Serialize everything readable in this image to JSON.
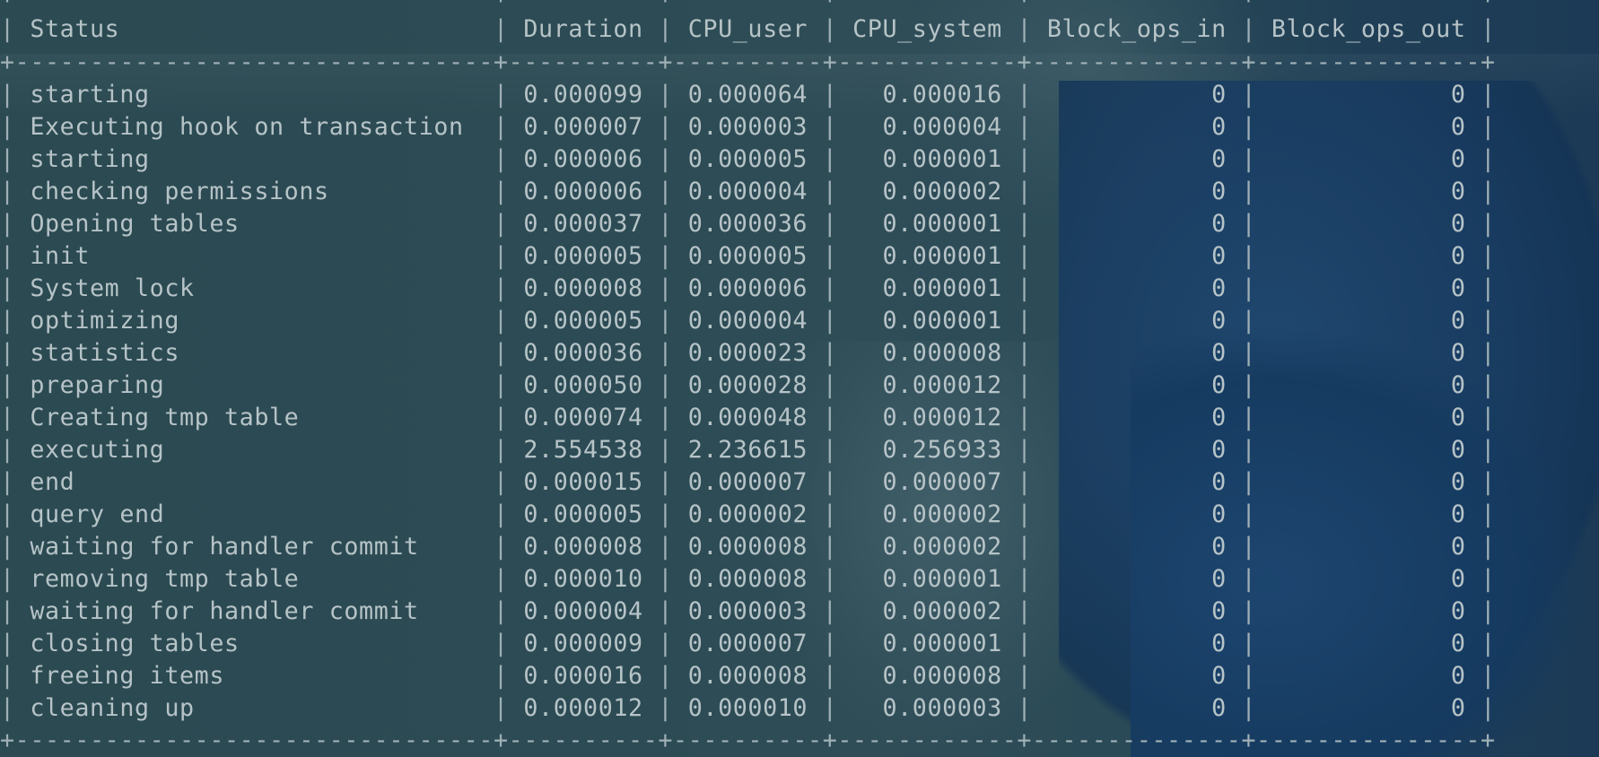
{
  "table": {
    "separator": "+--------------------------------+----------+----------+------------+--------------+---------------+",
    "columns": [
      "Status",
      "Duration",
      "CPU_user",
      "CPU_system",
      "Block_ops_in",
      "Block_ops_out"
    ],
    "rows": [
      [
        "starting",
        "0.000099",
        "0.000064",
        "0.000016",
        "0",
        "0"
      ],
      [
        "Executing hook on transaction",
        "0.000007",
        "0.000003",
        "0.000004",
        "0",
        "0"
      ],
      [
        "starting",
        "0.000006",
        "0.000005",
        "0.000001",
        "0",
        "0"
      ],
      [
        "checking permissions",
        "0.000006",
        "0.000004",
        "0.000002",
        "0",
        "0"
      ],
      [
        "Opening tables",
        "0.000037",
        "0.000036",
        "0.000001",
        "0",
        "0"
      ],
      [
        "init",
        "0.000005",
        "0.000005",
        "0.000001",
        "0",
        "0"
      ],
      [
        "System lock",
        "0.000008",
        "0.000006",
        "0.000001",
        "0",
        "0"
      ],
      [
        "optimizing",
        "0.000005",
        "0.000004",
        "0.000001",
        "0",
        "0"
      ],
      [
        "statistics",
        "0.000036",
        "0.000023",
        "0.000008",
        "0",
        "0"
      ],
      [
        "preparing",
        "0.000050",
        "0.000028",
        "0.000012",
        "0",
        "0"
      ],
      [
        "Creating tmp table",
        "0.000074",
        "0.000048",
        "0.000012",
        "0",
        "0"
      ],
      [
        "executing",
        "2.554538",
        "2.236615",
        "0.256933",
        "0",
        "0"
      ],
      [
        "end",
        "0.000015",
        "0.000007",
        "0.000007",
        "0",
        "0"
      ],
      [
        "query end",
        "0.000005",
        "0.000002",
        "0.000002",
        "0",
        "0"
      ],
      [
        "waiting for handler commit",
        "0.000008",
        "0.000008",
        "0.000002",
        "0",
        "0"
      ],
      [
        "removing tmp table",
        "0.000010",
        "0.000008",
        "0.000001",
        "0",
        "0"
      ],
      [
        "waiting for handler commit",
        "0.000004",
        "0.000003",
        "0.000002",
        "0",
        "0"
      ],
      [
        "closing tables",
        "0.000009",
        "0.000007",
        "0.000001",
        "0",
        "0"
      ],
      [
        "freeing items",
        "0.000016",
        "0.000008",
        "0.000008",
        "0",
        "0"
      ],
      [
        "cleaning up",
        "0.000012",
        "0.000010",
        "0.000003",
        "0",
        "0"
      ]
    ]
  },
  "colors": {
    "text": "#b6c3c7",
    "background": "#2b4d55",
    "photo_accent": "#1c3a55"
  }
}
